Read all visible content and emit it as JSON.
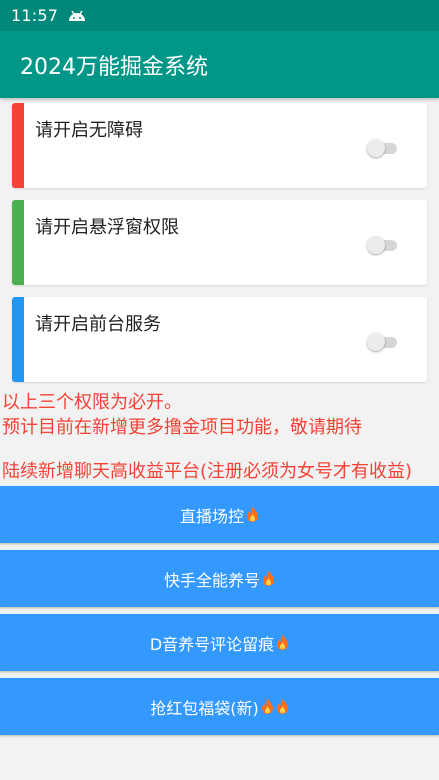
{
  "status_bar": {
    "time": "11:57",
    "notification_icon": "android-icon"
  },
  "app_bar": {
    "title": "2024万能掘金系统"
  },
  "permissions": [
    {
      "label": "请开启无障碍",
      "accent_color": "#f44336",
      "enabled": false
    },
    {
      "label": "请开启悬浮窗权限",
      "accent_color": "#4caf50",
      "enabled": false
    },
    {
      "label": "请开启前台服务",
      "accent_color": "#2196f3",
      "enabled": false
    }
  ],
  "notice": {
    "line1": "以上三个权限为必开。",
    "line2": "预计目前在新增更多撸金项目功能，敬请期待",
    "line3": "陆续新增聊天高收益平台(注册必须为女号才有收益)"
  },
  "actions": [
    {
      "label": "直播场控",
      "fire_count": 1
    },
    {
      "label": "快手全能养号",
      "fire_count": 1
    },
    {
      "label": "D音养号评论留痕",
      "fire_count": 1
    },
    {
      "label": "抢红包福袋(新)",
      "fire_count": 2
    }
  ],
  "colors": {
    "status_bar": "#00897b",
    "app_bar": "#009688",
    "notice_text": "#f44336",
    "action_button": "#3399ff"
  },
  "icons": {
    "status": "android-icon",
    "button_suffix": "fire-icon"
  }
}
